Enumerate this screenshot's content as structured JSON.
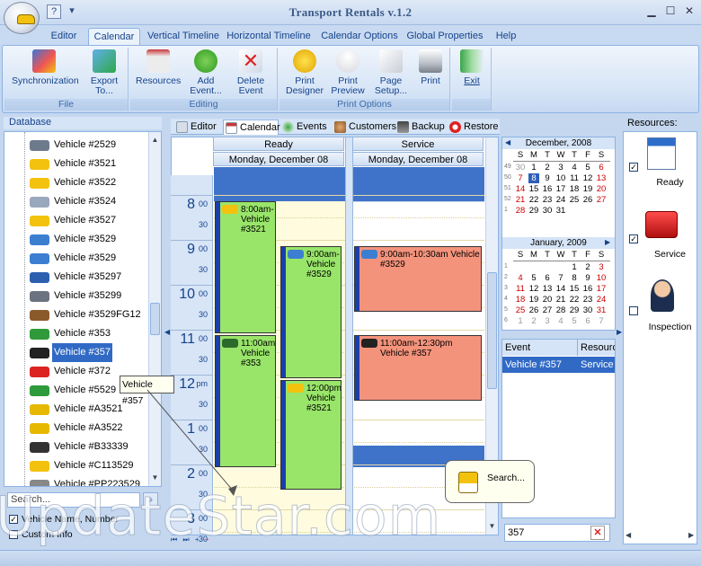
{
  "app": {
    "title": "Transport Rentals v.1.2"
  },
  "tabs": [
    "Editor",
    "Calendar",
    "Vertical Timeline",
    "Horizontal Timeline",
    "Calendar Options",
    "Global Properties",
    "Help"
  ],
  "ribbon": {
    "groups": {
      "file": "File",
      "editing": "Editing",
      "print_options": "Print Options"
    },
    "buttons": {
      "synchronization": "Synchronization",
      "export": "Export\nTo...",
      "resources": "Resources",
      "add_event": "Add\nEvent...",
      "delete_event": "Delete\nEvent",
      "print_designer": "Print\nDesigner",
      "print_preview": "Print\nPreview",
      "page_setup": "Page\nSetup...",
      "print": "Print",
      "exit": "Exit"
    }
  },
  "sidebar": {
    "title": "Database",
    "vehicles": [
      "Vehicle #2529",
      "Vehicle #3521",
      "Vehicle #3522",
      "Vehicle #3524",
      "Vehicle #3527",
      "Vehicle #3529",
      "Vehicle #3529",
      "Vehicle #35297",
      "Vehicle #35299",
      "Vehicle #3529FG12",
      "Vehicle #353",
      "Vehicle #357",
      "Vehicle #372",
      "Vehicle #5529",
      "Vehicle #A3521",
      "Vehicle #A3522",
      "Vehicle #B33339",
      "Vehicle #C113529",
      "Vehicle #PP223529"
    ],
    "selected_index": 11,
    "tooltip": "Vehicle #357",
    "search_placeholder": "Search...",
    "options": {
      "vehicle_name_number": "Vehicle Name, Number",
      "custom_info": "Custom Info"
    }
  },
  "subtabs": [
    "Editor",
    "Calendar",
    "Events",
    "Customers",
    "Backup",
    "Restore"
  ],
  "schedule": {
    "columns": [
      {
        "resource": "Ready",
        "date": "Monday, December 08"
      },
      {
        "resource": "Service",
        "date": "Monday, December 08"
      }
    ],
    "hours": [
      {
        "h": "8",
        "m": "00"
      },
      {
        "h": "9",
        "m": "00"
      },
      {
        "h": "10",
        "m": "00"
      },
      {
        "h": "11",
        "m": "00"
      },
      {
        "h": "12",
        "m": "pm"
      },
      {
        "h": "1",
        "m": "00"
      },
      {
        "h": "2",
        "m": "00"
      },
      {
        "h": "3",
        "m": "00"
      }
    ],
    "half": "30",
    "appointments": {
      "a1": "8:00am-\nVehicle\n#3521",
      "a2": "9:00am-\nVehicle\n#3529",
      "a3": "11:00am\nVehicle\n#353",
      "a4": "12:00pm\nVehicle\n#3521",
      "a5": "9:00am-10:30am Vehicle\n#3529",
      "a6": "11:00am-12:30pm\nVehicle #357"
    },
    "colors": {
      "ready": "#99e56a",
      "service": "#f4937c",
      "bar": "#1c3eab"
    }
  },
  "mini_calendar": {
    "dow": [
      "S",
      "M",
      "T",
      "W",
      "T",
      "F",
      "S"
    ],
    "dec": {
      "title": "December, 2008",
      "weeks": [
        "49",
        "50",
        "51",
        "52",
        "1"
      ],
      "rows": [
        [
          "30",
          "1",
          "2",
          "3",
          "4",
          "5",
          "6"
        ],
        [
          "7",
          "8",
          "9",
          "10",
          "11",
          "12",
          "13"
        ],
        [
          "14",
          "15",
          "16",
          "17",
          "18",
          "19",
          "20"
        ],
        [
          "21",
          "22",
          "23",
          "24",
          "25",
          "26",
          "27"
        ],
        [
          "28",
          "29",
          "30",
          "31",
          "",
          "",
          ""
        ]
      ]
    },
    "jan": {
      "title": "January, 2009",
      "weeks": [
        "1",
        "2",
        "3",
        "4",
        "5",
        "6"
      ],
      "rows": [
        [
          "",
          "",
          "",
          "",
          "1",
          "2",
          "3"
        ],
        [
          "4",
          "5",
          "6",
          "7",
          "8",
          "9",
          "10"
        ],
        [
          "11",
          "12",
          "13",
          "14",
          "15",
          "16",
          "17"
        ],
        [
          "18",
          "19",
          "20",
          "21",
          "22",
          "23",
          "24"
        ],
        [
          "25",
          "26",
          "27",
          "28",
          "29",
          "30",
          "31"
        ],
        [
          "1",
          "2",
          "3",
          "4",
          "5",
          "6",
          "7"
        ]
      ]
    }
  },
  "event_grid": {
    "headers": [
      "Event",
      "Resource"
    ],
    "row": [
      "Vehicle #357",
      "Service"
    ]
  },
  "resources": {
    "title": "Resources:",
    "items": [
      "Ready",
      "Service",
      "Inspection"
    ]
  },
  "callout": "Search...",
  "search_field": {
    "value": "357"
  },
  "watermark": "UpdateStar.com"
}
